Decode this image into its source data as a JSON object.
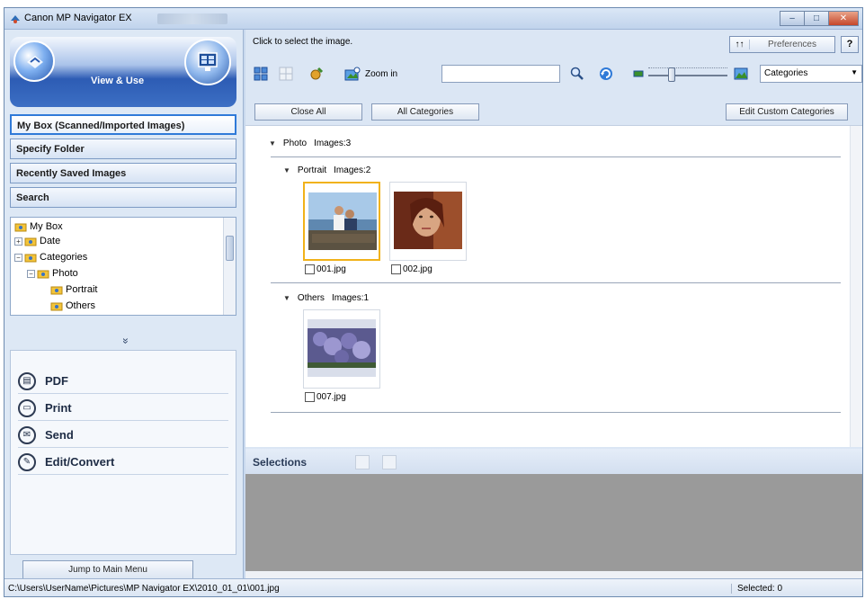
{
  "window": {
    "title": "Canon MP Navigator EX",
    "controls": {
      "minimize": "–",
      "maximize": "□",
      "close": "✕"
    }
  },
  "left_panel": {
    "mode_label": "View & Use",
    "nav": [
      "My Box (Scanned/Imported Images)",
      "Specify Folder",
      "Recently Saved Images",
      "Search"
    ],
    "tree": [
      "My Box",
      "Date",
      "Categories",
      "Photo",
      "Portrait",
      "Others"
    ],
    "collapse_glyph": "»",
    "actions": [
      "PDF",
      "Print",
      "Send",
      "Edit/Convert"
    ],
    "jump_button": "Jump to Main Menu"
  },
  "right_panel": {
    "hint": "Click to select the image.",
    "preferences_label": "Preferences",
    "help_label": "?",
    "zoom_label": "Zoom in",
    "search": {
      "value": "",
      "placeholder": ""
    },
    "view_select": "Categories",
    "buttons": {
      "close_all": "Close All",
      "all_categories": "All Categories",
      "edit_custom": "Edit Custom Categories"
    },
    "groups": {
      "photo": {
        "name": "Photo",
        "count": "Images:3"
      },
      "portrait": {
        "name": "Portrait",
        "count": "Images:2"
      },
      "others": {
        "name": "Others",
        "count": "Images:1"
      }
    },
    "images": [
      {
        "filename": "001.jpg",
        "selected": true
      },
      {
        "filename": "002.jpg",
        "selected": false
      },
      {
        "filename": "007.jpg",
        "selected": false
      }
    ],
    "selections_label": "Selections"
  },
  "status": {
    "path": "C:\\Users\\UserName\\Pictures\\MP Navigator EX\\2010_01_01\\001.jpg",
    "selected": "Selected: 0"
  },
  "colors": {
    "accent": "#2f7ad8",
    "selection_border": "#f1b21a",
    "header_blue": "#2d5cb4"
  }
}
